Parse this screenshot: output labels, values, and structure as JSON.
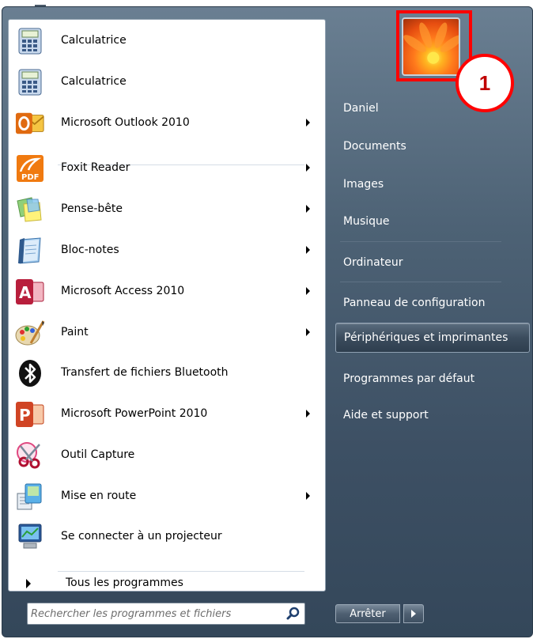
{
  "programs": [
    {
      "label": "Calculatrice",
      "icon": "calculator-icon",
      "submenu": false
    },
    {
      "label": "Calculatrice",
      "icon": "calculator-icon",
      "submenu": false
    },
    {
      "label": "Microsoft Outlook 2010",
      "icon": "outlook-icon",
      "submenu": true
    },
    {
      "label": "Foxit Reader",
      "icon": "pdf-icon",
      "submenu": true
    },
    {
      "label": "Pense-bête",
      "icon": "sticky-notes-icon",
      "submenu": true
    },
    {
      "label": "Bloc-notes",
      "icon": "notepad-icon",
      "submenu": true
    },
    {
      "label": "Microsoft Access 2010",
      "icon": "access-icon",
      "submenu": true
    },
    {
      "label": "Paint",
      "icon": "paint-palette-icon",
      "submenu": true
    },
    {
      "label": "Transfert de fichiers Bluetooth",
      "icon": "bluetooth-icon",
      "submenu": false
    },
    {
      "label": "Microsoft PowerPoint 2010",
      "icon": "powerpoint-icon",
      "submenu": true
    },
    {
      "label": "Outil Capture",
      "icon": "scissors-icon",
      "submenu": false
    },
    {
      "label": "Mise en route",
      "icon": "getting-started-icon",
      "submenu": true
    },
    {
      "label": "Se connecter à un projecteur",
      "icon": "projector-icon",
      "submenu": false
    }
  ],
  "all_programs_label": "Tous les programmes",
  "search": {
    "placeholder": "Rechercher les programmes et fichiers"
  },
  "right_items": [
    {
      "label": "Daniel"
    },
    {
      "label": "Documents"
    },
    {
      "label": "Images"
    },
    {
      "label": "Musique"
    },
    {
      "label": "Ordinateur"
    },
    {
      "label": "Panneau de configuration"
    },
    {
      "label": "Périphériques et imprimantes"
    },
    {
      "label": "Programmes par défaut"
    },
    {
      "label": "Aide et support"
    }
  ],
  "shutdown_label": "Arrêter",
  "callout_number": "1",
  "colors": {
    "highlight_border": "#ff0000",
    "frame": "#4d6275"
  }
}
